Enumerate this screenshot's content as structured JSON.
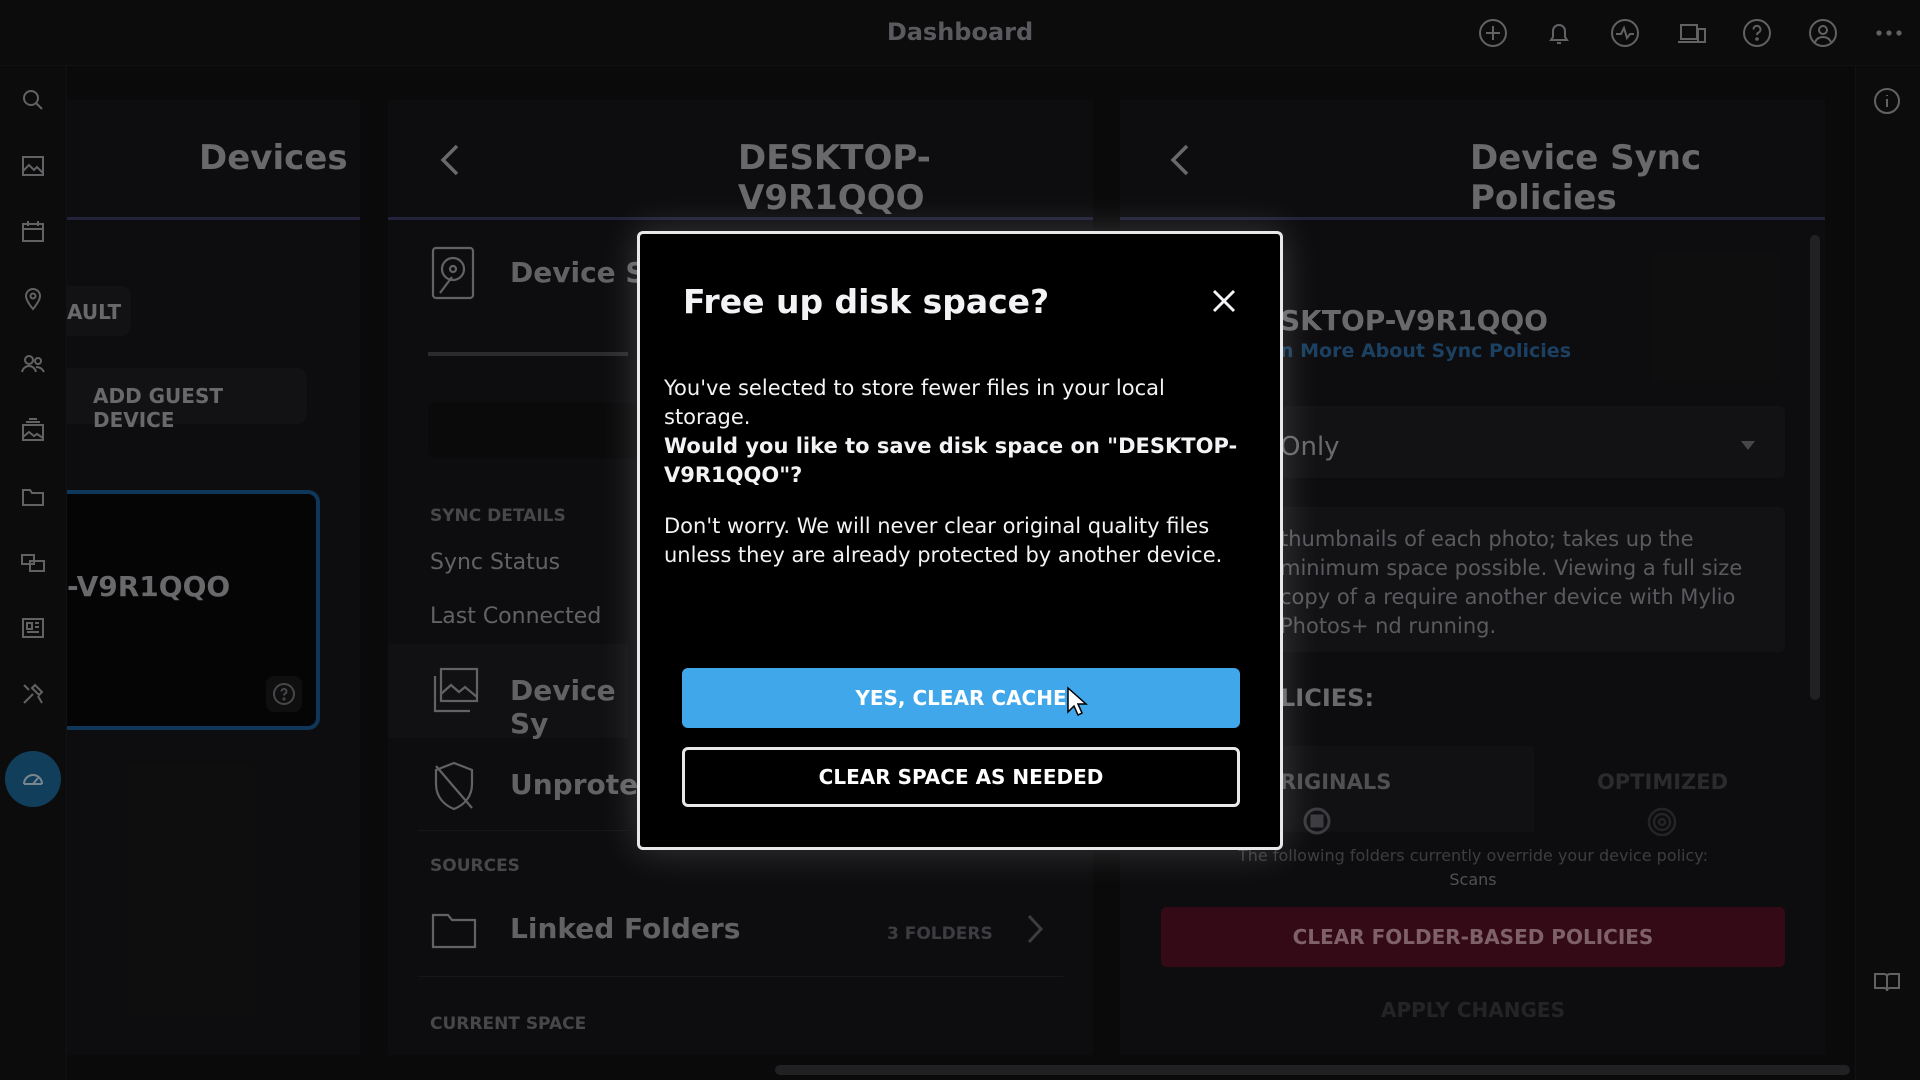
{
  "topbar": {
    "title": "Dashboard",
    "icons": [
      "add-icon",
      "bell-icon",
      "activity-icon",
      "devices-icon",
      "help-icon",
      "account-icon",
      "more-icon"
    ]
  },
  "leftnav": {
    "icons": [
      "search-icon",
      "photos-icon",
      "calendar-icon",
      "map-pin-icon",
      "people-icon",
      "albums-icon",
      "folder-icon",
      "sources-icon",
      "dashboard-grid-icon",
      "tools-icon",
      "dashboard-gauge-icon"
    ],
    "active": "dashboard-gauge-icon"
  },
  "devices_panel": {
    "title": "Devices",
    "default_chip": "AULT",
    "add_guest_label": "ADD GUEST DEVICE",
    "card_name": "-V9R1QQO"
  },
  "device_panel": {
    "title": "DESKTOP-V9R1QQO",
    "storage_label": "Device Sto",
    "sync_details_header": "SYNC DETAILS",
    "sync_status_label": "Sync Status",
    "last_connected_label": "Last Connected",
    "device_sync_label": "Device Sy",
    "unprotected_label": "Unprotect",
    "sources_header": "SOURCES",
    "linked_folders_label": "Linked Folders",
    "linked_folders_count": "3 FOLDERS",
    "current_space_header": "CURRENT SPACE"
  },
  "policies_panel": {
    "title": "Device Sync Policies",
    "device_name": "SKTOP-V9R1QQO",
    "learn_more": "n More About Sync Policies",
    "selected_policy": "Only",
    "description": "thumbnails of each photo; takes up the minimum space possible. Viewing a full size copy of a require another device with Mylio Photos+ nd running.",
    "policies_header": "LICIES:",
    "col_originals": "RIGINALS",
    "col_optimized": "OPTIMIZED",
    "override_note": "The following folders currently override your device policy:",
    "override_folder": "Scans",
    "clear_folder_btn": "CLEAR FOLDER-BASED POLICIES",
    "apply_changes": "APPLY CHANGES"
  },
  "modal": {
    "title": "Free up disk space?",
    "body_line": "You've selected to store fewer files in your local storage.",
    "body_bold": "Would you like to save disk space on \"DESKTOP-V9R1QQO\"?",
    "note": "Don't worry. We will never clear original quality files unless they are already protected by another device.",
    "primary_button": "YES, CLEAR CACHE",
    "secondary_button": "CLEAR SPACE AS NEEDED"
  }
}
